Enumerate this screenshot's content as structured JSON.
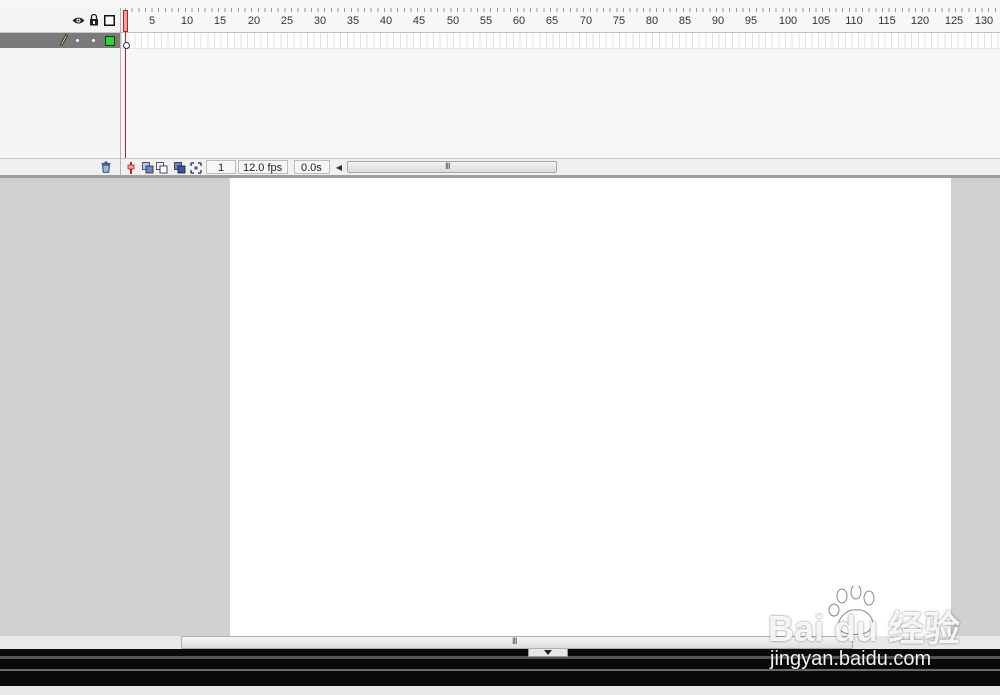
{
  "timeline": {
    "header_icons": [
      "eye-icon",
      "lock-icon",
      "outline-icon"
    ],
    "ruler_labels": [
      "5",
      "10",
      "15",
      "20",
      "25",
      "30",
      "35",
      "40",
      "45",
      "50",
      "55",
      "60",
      "65",
      "70",
      "75",
      "80",
      "85",
      "90",
      "95",
      "100",
      "105",
      "110",
      "115",
      "120",
      "125",
      "130"
    ],
    "layer": {
      "color": "#2fd03b",
      "icons": [
        "pencil-icon"
      ]
    },
    "footer": {
      "current_frame": "1",
      "frame_rate": "12.0 fps",
      "elapsed_time": "0.0s",
      "scroll_grip": "III"
    }
  },
  "stage": {
    "background": "#ffffff",
    "workspace_color": "#d0d0d0",
    "scroll_grip": "III"
  },
  "watermark": {
    "logo": "Bai  du 经验",
    "url": "jingyan.baidu.com"
  }
}
